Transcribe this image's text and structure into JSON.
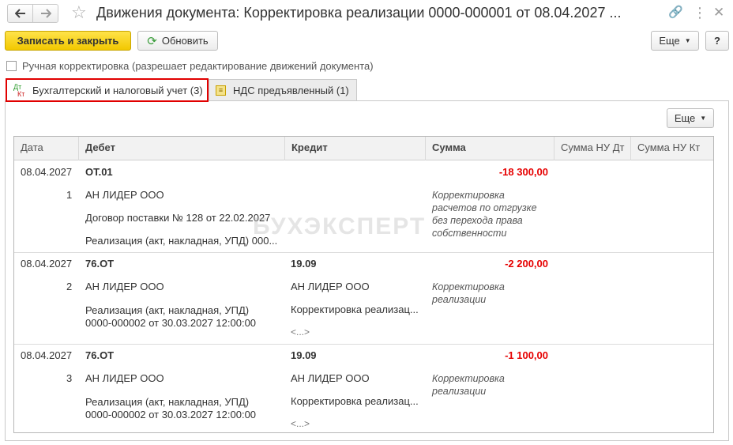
{
  "window": {
    "title": "Движения документа: Корректировка реализации 0000-000001 от 08.04.2027 ..."
  },
  "toolbar": {
    "save_close": "Записать и закрыть",
    "refresh": "Обновить",
    "more": "Еще",
    "help": "?"
  },
  "manual": {
    "label": "Ручная корректировка (разрешает редактирование движений документа)",
    "checked": false
  },
  "tabs": [
    {
      "label": "Бухгалтерский и налоговый учет (3)",
      "icon": "dt-kt-icon",
      "active": true
    },
    {
      "label": "НДС предъявленный (1)",
      "icon": "nds-icon",
      "active": false
    }
  ],
  "grid": {
    "more": "Еще",
    "columns": [
      "Дата",
      "Дебет",
      "Кредит",
      "Сумма",
      "Сумма НУ Дт",
      "Сумма НУ Кт"
    ],
    "rows": [
      {
        "date": "08.04.2027",
        "num": "1",
        "debit_account": "ОТ.01",
        "debit_sub1": "АН ЛИДЕР ООО",
        "debit_sub2": "Договор поставки № 128 от 22.02.2027",
        "debit_sub3": "Реализация (акт, накладная, УПД) 000...",
        "credit_account": "",
        "credit_sub1": "",
        "credit_sub2": "",
        "credit_sub3": "",
        "amount": "-18 300,00",
        "comment": "Корректировка расчетов по отгрузке без перехода права собственности"
      },
      {
        "date": "08.04.2027",
        "num": "2",
        "debit_account": "76.ОТ",
        "debit_sub1": "АН ЛИДЕР ООО",
        "debit_sub2": "Реализация (акт, накладная, УПД) 0000-000002 от 30.03.2027 12:00:00",
        "debit_sub3": "",
        "credit_account": "19.09",
        "credit_sub1": "АН ЛИДЕР ООО",
        "credit_sub2": "Корректировка реализац...",
        "credit_sub3": "<...>",
        "amount": "-2 200,00",
        "comment": "Корректировка реализации"
      },
      {
        "date": "08.04.2027",
        "num": "3",
        "debit_account": "76.ОТ",
        "debit_sub1": "АН ЛИДЕР ООО",
        "debit_sub2": "Реализация (акт, накладная, УПД) 0000-000002 от 30.03.2027 12:00:00",
        "debit_sub3": "",
        "credit_account": "19.09",
        "credit_sub1": "АН ЛИДЕР ООО",
        "credit_sub2": "Корректировка реализац...",
        "credit_sub3": "<...>",
        "amount": "-1 100,00",
        "comment": "Корректировка реализации"
      }
    ]
  },
  "watermark": "БУХЭКСПЕРТ",
  "colors": {
    "primary_button": "#f2c800",
    "negative_amount": "#e60000",
    "active_tab_outline": "#e10000"
  }
}
